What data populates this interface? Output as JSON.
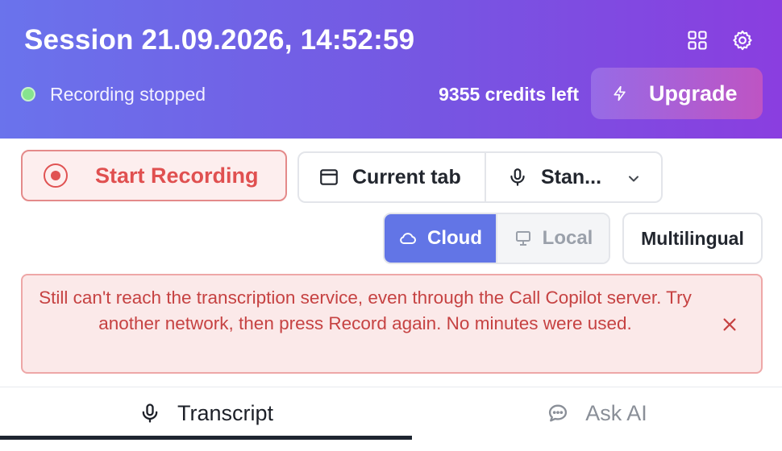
{
  "header": {
    "title": "Session 21.09.2026, 14:52:59",
    "status": "Recording stopped",
    "status_color": "#86e38f",
    "credits": "9355 credits left",
    "upgrade_label": "Upgrade",
    "icons": [
      "grid-icon",
      "gear-icon",
      "lightning-icon"
    ]
  },
  "controls": {
    "record_label": "Start Recording",
    "source_tab_label": "Current tab",
    "mic_label": "Stan...",
    "mode_cloud_label": "Cloud",
    "mode_local_label": "Local",
    "mode_selected": "Cloud",
    "multilingual_label": "Multilingual"
  },
  "error": {
    "message": "Still can't reach the transcription service, even through the Call Copilot server. Try another network, then press Record again. No minutes were used."
  },
  "tabs": [
    {
      "label": "Transcript",
      "active": true
    },
    {
      "label": "Ask AI",
      "active": false
    }
  ],
  "colors": {
    "accent": "#6275e6",
    "danger": "#e05050",
    "error_bg": "#fbe9e9"
  }
}
